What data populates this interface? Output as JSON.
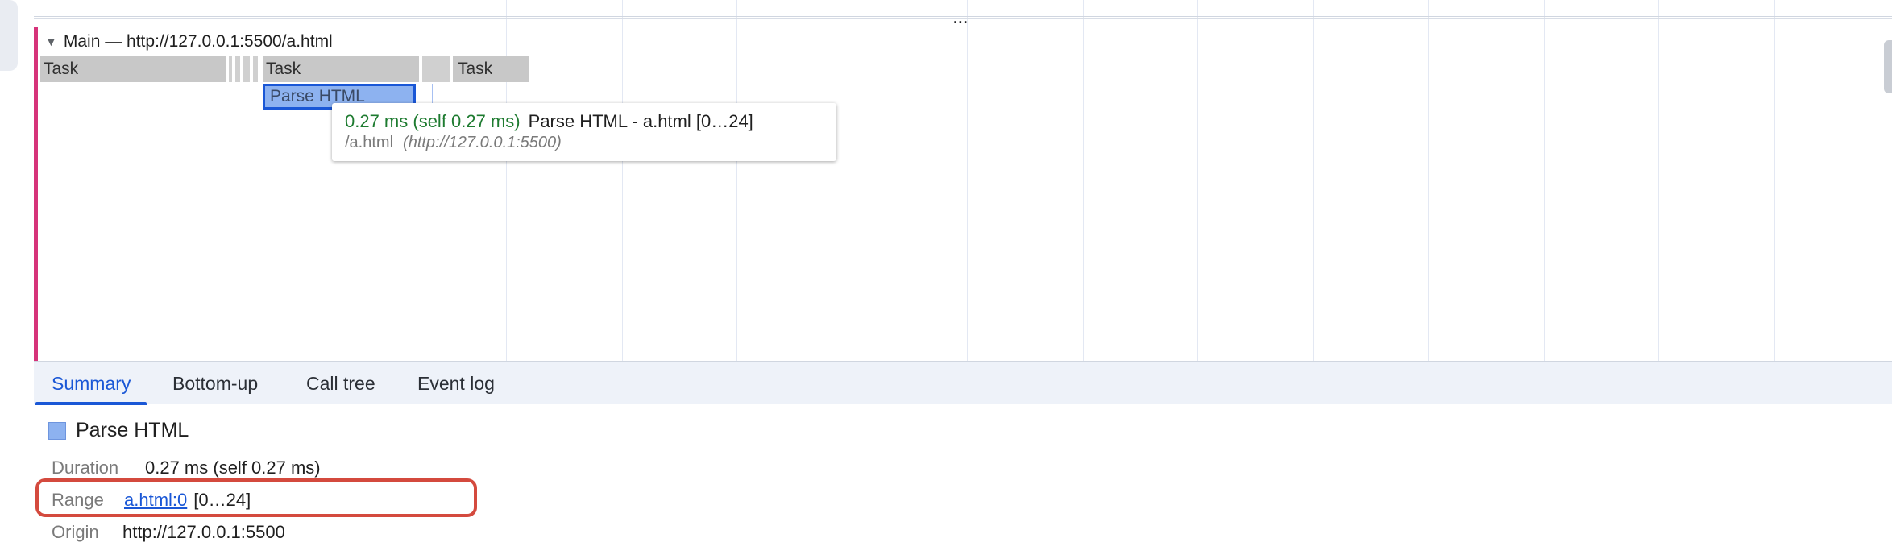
{
  "flame_chart": {
    "track_title": "Main — http://127.0.0.1:5500/a.html",
    "more_indicator": "...",
    "tasks": [
      {
        "label": "Task"
      },
      {
        "label": "Task"
      },
      {
        "label": "Task"
      }
    ],
    "selected_event": {
      "label": "Parse HTML",
      "color": "#8db2f0",
      "border_color": "#1a57d6"
    },
    "tooltip": {
      "timing": "0.27 ms (self 0.27 ms)",
      "title": "Parse HTML - a.html [0…24]",
      "file": "/a.html",
      "origin": "(http://127.0.0.1:5500)"
    }
  },
  "tabs": [
    {
      "label": "Summary",
      "active": true
    },
    {
      "label": "Bottom-up",
      "active": false
    },
    {
      "label": "Call tree",
      "active": false
    },
    {
      "label": "Event log",
      "active": false
    }
  ],
  "summary": {
    "title": "Parse HTML",
    "duration_label": "Duration",
    "duration_value": "0.27 ms (self 0.27 ms)",
    "range_label": "Range",
    "range_link": "a.html:0",
    "range_value": "[0…24]",
    "origin_label": "Origin",
    "origin_value": "http://127.0.0.1:5500"
  },
  "colors": {
    "accent": "#1a57d6",
    "track_marker": "#d6337a",
    "highlight": "#d44a3e",
    "timing_green": "#1e7b30"
  }
}
